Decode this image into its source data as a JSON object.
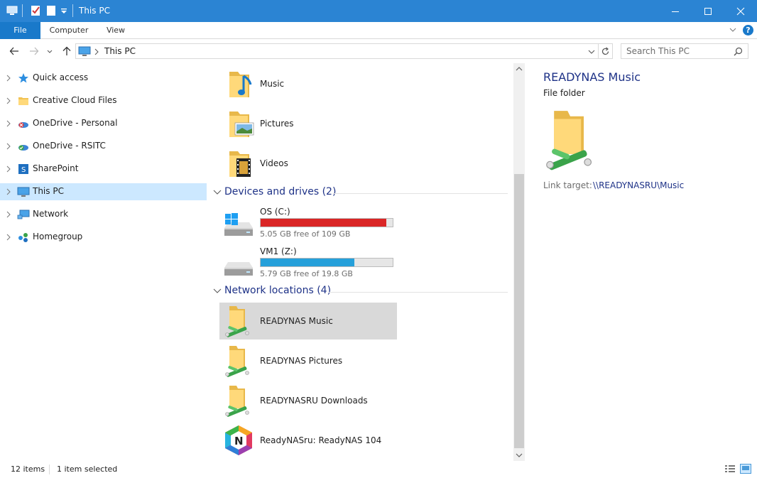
{
  "window": {
    "title": "This PC",
    "accent": "#2b84d3"
  },
  "ribbon": {
    "tabs": [
      {
        "label": "File"
      },
      {
        "label": "Computer"
      },
      {
        "label": "View"
      }
    ],
    "help_glyph": "?"
  },
  "address": {
    "crumb": "This PC",
    "search_placeholder": "Search This PC"
  },
  "nav": {
    "items": [
      {
        "label": "Quick access",
        "icon": "star-icon"
      },
      {
        "label": "Creative Cloud Files",
        "icon": "folder-icon"
      },
      {
        "label": "OneDrive - Personal",
        "icon": "onedrive-icon"
      },
      {
        "label": "OneDrive - RSITC",
        "icon": "onedrive-icon"
      },
      {
        "label": "SharePoint",
        "icon": "sharepoint-icon"
      },
      {
        "label": "This PC",
        "icon": "computer-icon",
        "selected": true
      },
      {
        "label": "Network",
        "icon": "network-icon"
      },
      {
        "label": "Homegroup",
        "icon": "homegroup-icon"
      }
    ]
  },
  "content": {
    "folders": [
      {
        "label": "Music",
        "icon": "music-folder-icon"
      },
      {
        "label": "Pictures",
        "icon": "pictures-folder-icon"
      },
      {
        "label": "Videos",
        "icon": "videos-folder-icon"
      }
    ],
    "groups": {
      "devices": "Devices and drives (2)",
      "network": "Network locations (4)"
    },
    "drives": [
      {
        "label": "OS (C:)",
        "free": "5.05 GB free of 109 GB",
        "used_fraction": 0.954,
        "bar_color": "#da2626"
      },
      {
        "label": "VM1 (Z:)",
        "free": "5.79 GB free of 19.8 GB",
        "used_fraction": 0.708,
        "bar_color": "#26a0da"
      }
    ],
    "network_locations": [
      {
        "label": "READYNAS Music",
        "selected": true
      },
      {
        "label": "READYNAS Pictures"
      },
      {
        "label": "READYNASRU Downloads"
      },
      {
        "label": "ReadyNASru: ReadyNAS 104"
      }
    ]
  },
  "details": {
    "title": "READYNAS Music",
    "type": "File folder",
    "link_target_label": "Link target:",
    "link_target_value": "\\\\READYNASRU\\Music"
  },
  "status": {
    "count": "12 items",
    "selected": "1 item selected"
  }
}
